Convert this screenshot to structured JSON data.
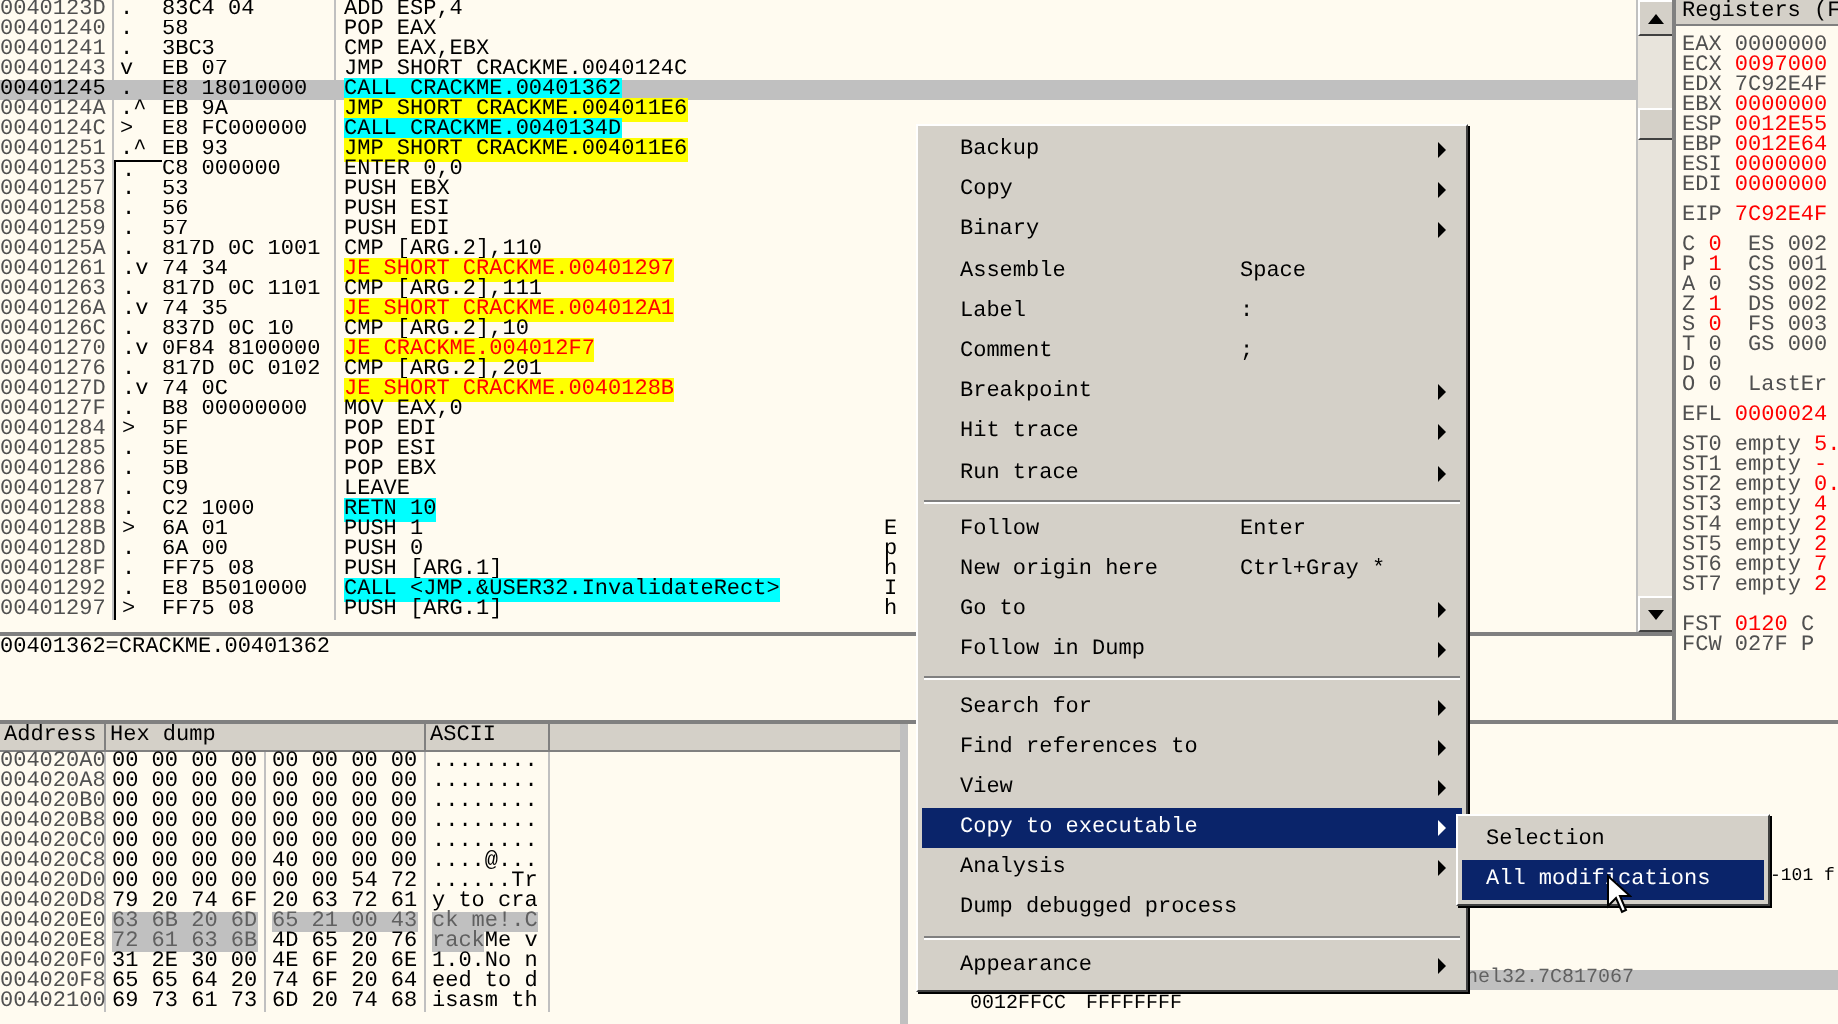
{
  "disassembly": {
    "rows": [
      {
        "address": "0040123D",
        "marker": ".",
        "hex": "83C4 04",
        "asm": "ADD ESP,4",
        "kind": "plain",
        "selected": false,
        "bracket_start": false,
        "bracketed": false
      },
      {
        "address": "00401240",
        "marker": ".",
        "hex": "58",
        "asm": "POP EAX",
        "kind": "plain",
        "selected": false,
        "bracket_start": false,
        "bracketed": false
      },
      {
        "address": "00401241",
        "marker": ".",
        "hex": "3BC3",
        "asm": "CMP EAX,EBX",
        "kind": "plain",
        "selected": false,
        "bracket_start": false,
        "bracketed": false
      },
      {
        "address": "00401243",
        "marker": "v",
        "hex": "EB 07",
        "asm": "JMP SHORT CRACKME.0040124C",
        "kind": "plain",
        "selected": false,
        "bracket_start": false,
        "bracketed": false
      },
      {
        "address": "00401245",
        "marker": ".",
        "hex": "E8 18010000",
        "asm": "CALL CRACKME.00401362",
        "kind": "call",
        "selected": true,
        "bracket_start": false,
        "bracketed": false
      },
      {
        "address": "0040124A",
        "marker": ".^",
        "hex": "EB 9A",
        "asm": "JMP SHORT CRACKME.004011E6",
        "kind": "jump",
        "selected": false,
        "bracket_start": false,
        "bracketed": false
      },
      {
        "address": "0040124C",
        "marker": ">",
        "hex": "E8 FC000000",
        "asm": "CALL CRACKME.0040134D",
        "kind": "call",
        "selected": false,
        "bracket_start": false,
        "bracketed": false
      },
      {
        "address": "00401251",
        "marker": ".^",
        "hex": "EB 93",
        "asm": "JMP SHORT CRACKME.004011E6",
        "kind": "jump",
        "selected": false,
        "bracket_start": false,
        "bracketed": false
      },
      {
        "address": "00401253",
        "marker": ".",
        "hex": "C8 000000",
        "asm": "ENTER 0,0",
        "kind": "plain",
        "selected": false,
        "bracket_start": true,
        "bracketed": true
      },
      {
        "address": "00401257",
        "marker": ".",
        "hex": "53",
        "asm": "PUSH EBX",
        "kind": "plain",
        "selected": false,
        "bracket_start": false,
        "bracketed": true
      },
      {
        "address": "00401258",
        "marker": ".",
        "hex": "56",
        "asm": "PUSH ESI",
        "kind": "plain",
        "selected": false,
        "bracket_start": false,
        "bracketed": true
      },
      {
        "address": "00401259",
        "marker": ".",
        "hex": "57",
        "asm": "PUSH EDI",
        "kind": "plain",
        "selected": false,
        "bracket_start": false,
        "bracketed": true
      },
      {
        "address": "0040125A",
        "marker": ".",
        "hex": "817D 0C 1001",
        "asm": "CMP [ARG.2],110",
        "kind": "plain",
        "selected": false,
        "bracket_start": false,
        "bracketed": true
      },
      {
        "address": "00401261",
        "marker": ".v",
        "hex": "74 34",
        "asm": "JE SHORT CRACKME.00401297",
        "kind": "cond_jump",
        "selected": false,
        "bracket_start": false,
        "bracketed": true
      },
      {
        "address": "00401263",
        "marker": ".",
        "hex": "817D 0C 1101",
        "asm": "CMP [ARG.2],111",
        "kind": "plain",
        "selected": false,
        "bracket_start": false,
        "bracketed": true
      },
      {
        "address": "0040126A",
        "marker": ".v",
        "hex": "74 35",
        "asm": "JE SHORT CRACKME.004012A1",
        "kind": "cond_jump",
        "selected": false,
        "bracket_start": false,
        "bracketed": true
      },
      {
        "address": "0040126C",
        "marker": ".",
        "hex": "837D 0C 10",
        "asm": "CMP [ARG.2],10",
        "kind": "plain",
        "selected": false,
        "bracket_start": false,
        "bracketed": true
      },
      {
        "address": "00401270",
        "marker": ".v",
        "hex": "0F84 8100000",
        "asm": "JE CRACKME.004012F7",
        "kind": "cond_jump",
        "selected": false,
        "bracket_start": false,
        "bracketed": true
      },
      {
        "address": "00401276",
        "marker": ".",
        "hex": "817D 0C 0102",
        "asm": "CMP [ARG.2],201",
        "kind": "plain",
        "selected": false,
        "bracket_start": false,
        "bracketed": true
      },
      {
        "address": "0040127D",
        "marker": ".v",
        "hex": "74 0C",
        "asm": "JE SHORT CRACKME.0040128B",
        "kind": "cond_jump",
        "selected": false,
        "bracket_start": false,
        "bracketed": true
      },
      {
        "address": "0040127F",
        "marker": ".",
        "hex": "B8 00000000",
        "asm": "MOV EAX,0",
        "kind": "plain",
        "selected": false,
        "bracket_start": false,
        "bracketed": true
      },
      {
        "address": "00401284",
        "marker": ">",
        "hex": "5F",
        "asm": "POP EDI",
        "kind": "plain",
        "selected": false,
        "bracket_start": false,
        "bracketed": true
      },
      {
        "address": "00401285",
        "marker": ".",
        "hex": "5E",
        "asm": "POP ESI",
        "kind": "plain",
        "selected": false,
        "bracket_start": false,
        "bracketed": true
      },
      {
        "address": "00401286",
        "marker": ".",
        "hex": "5B",
        "asm": "POP EBX",
        "kind": "plain",
        "selected": false,
        "bracket_start": false,
        "bracketed": true
      },
      {
        "address": "00401287",
        "marker": ".",
        "hex": "C9",
        "asm": "LEAVE",
        "kind": "plain",
        "selected": false,
        "bracket_start": false,
        "bracketed": true
      },
      {
        "address": "00401288",
        "marker": ".",
        "hex": "C2 1000",
        "asm": "RETN 10",
        "kind": "call",
        "selected": false,
        "bracket_start": false,
        "bracketed": true
      },
      {
        "address": "0040128B",
        "marker": ">",
        "hex": "6A 01",
        "asm": "PUSH 1",
        "kind": "plain",
        "selected": false,
        "bracket_start": false,
        "bracketed": true,
        "comment": "E"
      },
      {
        "address": "0040128D",
        "marker": ".",
        "hex": "6A 00",
        "asm": "PUSH 0",
        "kind": "plain",
        "selected": false,
        "bracket_start": false,
        "bracketed": true,
        "comment": "p"
      },
      {
        "address": "0040128F",
        "marker": ".",
        "hex": "FF75 08",
        "asm": "PUSH [ARG.1]",
        "kind": "plain",
        "selected": false,
        "bracket_start": false,
        "bracketed": true,
        "comment": "h"
      },
      {
        "address": "00401292",
        "marker": ".",
        "hex": "E8 B5010000",
        "asm": "CALL <JMP.&USER32.InvalidateRect>",
        "kind": "call",
        "selected": false,
        "bracket_start": false,
        "bracketed": true,
        "comment": "I"
      },
      {
        "address": "00401297",
        "marker": ">",
        "hex": "FF75 08",
        "asm": "PUSH [ARG.1]",
        "kind": "plain",
        "selected": false,
        "bracket_start": false,
        "bracketed": true,
        "comment": "h"
      }
    ]
  },
  "info_line": "00401362=CRACKME.00401362",
  "registers": {
    "title": "Registers (F",
    "general": [
      {
        "name": "EAX",
        "value": "0000000",
        "changed": false
      },
      {
        "name": "ECX",
        "value": "0097000",
        "changed": true
      },
      {
        "name": "EDX",
        "value": "7C92E4F",
        "changed": false
      },
      {
        "name": "EBX",
        "value": "0000000",
        "changed": true
      },
      {
        "name": "ESP",
        "value": "0012E55",
        "changed": true
      },
      {
        "name": "EBP",
        "value": "0012E64",
        "changed": true
      },
      {
        "name": "ESI",
        "value": "0000000",
        "changed": true
      },
      {
        "name": "EDI",
        "value": "0000000",
        "changed": true
      }
    ],
    "eip": {
      "name": "EIP",
      "value": "7C92E4F",
      "changed": true
    },
    "flags": [
      {
        "name": "C",
        "value": "0",
        "changed": true,
        "segment": "ES 002"
      },
      {
        "name": "P",
        "value": "1",
        "changed": true,
        "segment": "CS 001"
      },
      {
        "name": "A",
        "value": "0",
        "changed": false,
        "segment": "SS 002"
      },
      {
        "name": "Z",
        "value": "1",
        "changed": true,
        "segment": "DS 002"
      },
      {
        "name": "S",
        "value": "0",
        "changed": true,
        "segment": "FS 003"
      },
      {
        "name": "T",
        "value": "0",
        "changed": false,
        "segment": "GS 000"
      },
      {
        "name": "D",
        "value": "0",
        "changed": false
      },
      {
        "name": "O",
        "value": "0",
        "changed": false,
        "segment": "LastEr"
      }
    ],
    "efl": {
      "name": "EFL",
      "value": "0000024",
      "changed": true
    },
    "fpu": [
      {
        "name": "ST0",
        "tag": "empty",
        "value": "5."
      },
      {
        "name": "ST1",
        "tag": "empty",
        "value": "-"
      },
      {
        "name": "ST2",
        "tag": "empty",
        "value": "0."
      },
      {
        "name": "ST3",
        "tag": "empty",
        "value": "4"
      },
      {
        "name": "ST4",
        "tag": "empty",
        "value": "2"
      },
      {
        "name": "ST5",
        "tag": "empty",
        "value": "2"
      },
      {
        "name": "ST6",
        "tag": "empty",
        "value": "7"
      },
      {
        "name": "ST7",
        "tag": "empty",
        "value": "2"
      }
    ],
    "status": [
      {
        "name": "FST",
        "value": "0120",
        "changed": true,
        "extra": "C"
      },
      {
        "name": "FCW",
        "value": "027F",
        "changed": false,
        "extra": "P"
      }
    ]
  },
  "dump": {
    "columns": [
      "Address",
      "Hex dump",
      "ASCII"
    ],
    "rows": [
      {
        "address": "004020A0",
        "hex": [
          {
            "text": "00 00 00 00",
            "selected": false
          },
          {
            "text": "00 00 00 00",
            "selected": false
          }
        ],
        "ascii": [
          {
            "text": "........",
            "selected": false
          }
        ]
      },
      {
        "address": "004020A8",
        "hex": [
          {
            "text": "00 00 00 00",
            "selected": false
          },
          {
            "text": "00 00 00 00",
            "selected": false
          }
        ],
        "ascii": [
          {
            "text": "........",
            "selected": false
          }
        ]
      },
      {
        "address": "004020B0",
        "hex": [
          {
            "text": "00 00 00 00",
            "selected": false
          },
          {
            "text": "00 00 00 00",
            "selected": false
          }
        ],
        "ascii": [
          {
            "text": "........",
            "selected": false
          }
        ]
      },
      {
        "address": "004020B8",
        "hex": [
          {
            "text": "00 00 00 00",
            "selected": false
          },
          {
            "text": "00 00 00 00",
            "selected": false
          }
        ],
        "ascii": [
          {
            "text": "........",
            "selected": false
          }
        ]
      },
      {
        "address": "004020C0",
        "hex": [
          {
            "text": "00 00 00 00",
            "selected": false
          },
          {
            "text": "00 00 00 00",
            "selected": false
          }
        ],
        "ascii": [
          {
            "text": "........",
            "selected": false
          }
        ]
      },
      {
        "address": "004020C8",
        "hex": [
          {
            "text": "00 00 00 00",
            "selected": false
          },
          {
            "text": "40 00 00 00",
            "selected": false
          }
        ],
        "ascii": [
          {
            "text": "....@...",
            "selected": false
          }
        ]
      },
      {
        "address": "004020D0",
        "hex": [
          {
            "text": "00 00 00 00",
            "selected": false
          },
          {
            "text": "00 00 54 72",
            "selected": false
          }
        ],
        "ascii": [
          {
            "text": "......Tr",
            "selected": false
          }
        ]
      },
      {
        "address": "004020D8",
        "hex": [
          {
            "text": "79 20 74 6F",
            "selected": false
          },
          {
            "text": "20 63 72 61",
            "selected": false
          }
        ],
        "ascii": [
          {
            "text": "y to cra",
            "selected": false
          }
        ]
      },
      {
        "address": "004020E0",
        "hex": [
          {
            "text": "63 6B 20 6D",
            "selected": true
          },
          {
            "text": "65 21 00 43",
            "selected": true
          }
        ],
        "ascii": [
          {
            "text": "ck me!.C",
            "selected": true
          }
        ]
      },
      {
        "address": "004020E8",
        "hex": [
          {
            "text": "72 61 63 6B",
            "selected": true
          },
          {
            "text": "4D 65 20 76",
            "selected": false
          }
        ],
        "ascii": [
          {
            "text": "rack",
            "selected": true
          },
          {
            "text": "Me v",
            "selected": false
          }
        ]
      },
      {
        "address": "004020F0",
        "hex": [
          {
            "text": "31 2E 30 00",
            "selected": false
          },
          {
            "text": "4E 6F 20 6E",
            "selected": false
          }
        ],
        "ascii": [
          {
            "text": "1.0.No n",
            "selected": false
          }
        ]
      },
      {
        "address": "004020F8",
        "hex": [
          {
            "text": "65 65 64 20",
            "selected": false
          },
          {
            "text": "74 6F 20 64",
            "selected": false
          }
        ],
        "ascii": [
          {
            "text": "eed to d",
            "selected": false
          }
        ]
      },
      {
        "address": "00402100",
        "hex": [
          {
            "text": "69 73 61 73",
            "selected": false
          },
          {
            "text": "6D 20 74 68",
            "selected": false
          }
        ],
        "ascii": [
          {
            "text": "isasm th",
            "selected": false
          }
        ]
      }
    ]
  },
  "stack": {
    "rows": [
      {
        "column_4": "-101 f",
        "selected": false
      },
      {
        "comment": "nel32.7C817067",
        "selected": true
      },
      {
        "address": "0012FFCC",
        "value": "FFFFFFFF",
        "selected": false
      }
    ]
  },
  "context_menu": {
    "groups": [
      [
        {
          "label": "Backup",
          "submenu": true,
          "selected": false
        },
        {
          "label": "Copy",
          "submenu": true,
          "selected": false
        },
        {
          "label": "Binary",
          "submenu": true,
          "selected": false
        },
        {
          "label": "Assemble",
          "shortcut": "Space",
          "submenu": false,
          "selected": false
        },
        {
          "label": "Label",
          "shortcut": ":",
          "submenu": false,
          "selected": false
        },
        {
          "label": "Comment",
          "shortcut": ";",
          "submenu": false,
          "selected": false
        },
        {
          "label": "Breakpoint",
          "submenu": true,
          "selected": false
        },
        {
          "label": "Hit trace",
          "submenu": true,
          "selected": false
        },
        {
          "label": "Run trace",
          "submenu": true,
          "selected": false
        }
      ],
      [
        {
          "label": "Follow",
          "shortcut": "Enter",
          "submenu": false,
          "selected": false
        },
        {
          "label": "New origin here",
          "shortcut": "Ctrl+Gray *",
          "submenu": false,
          "selected": false
        },
        {
          "label": "Go to",
          "submenu": true,
          "selected": false
        },
        {
          "label": "Follow in Dump",
          "submenu": true,
          "selected": false
        }
      ],
      [
        {
          "label": "Search for",
          "submenu": true,
          "selected": false
        },
        {
          "label": "Find references to",
          "submenu": true,
          "selected": false
        },
        {
          "label": "View",
          "submenu": true,
          "selected": false
        },
        {
          "label": "Copy to executable",
          "submenu": true,
          "selected": true
        },
        {
          "label": "Analysis",
          "submenu": true,
          "selected": false
        },
        {
          "label": "Dump debugged process",
          "submenu": false,
          "selected": false
        }
      ],
      [
        {
          "label": "Appearance",
          "submenu": true,
          "selected": false
        }
      ]
    ]
  },
  "submenu": {
    "items": [
      {
        "label": "Selection",
        "selected": false
      },
      {
        "label": "All modifications",
        "selected": true
      }
    ]
  }
}
